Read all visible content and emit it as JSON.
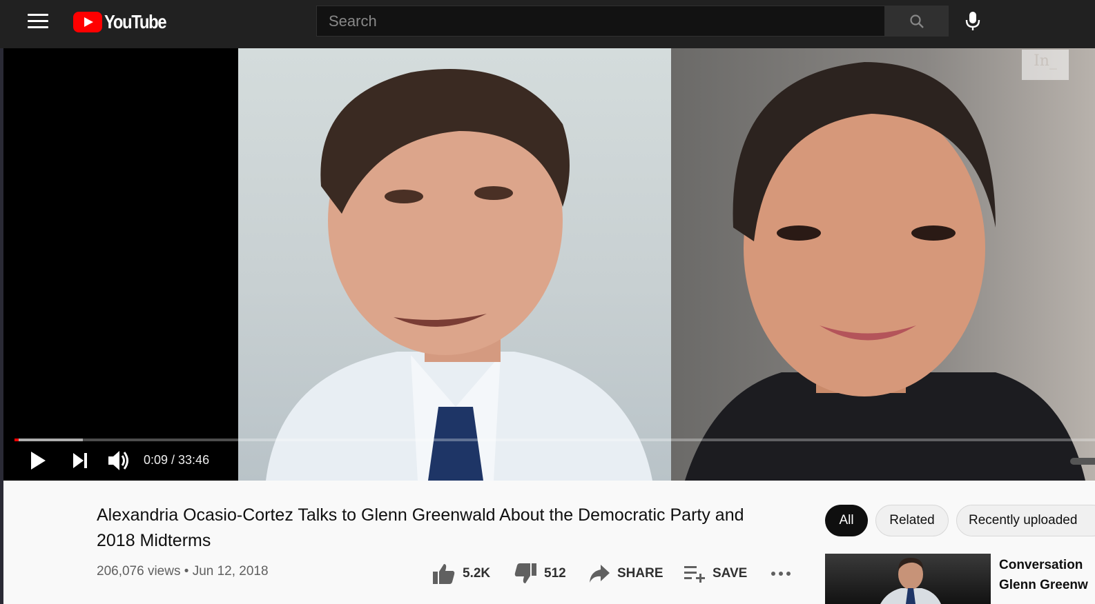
{
  "header": {
    "logo_text": "YouTube",
    "search_placeholder": "Search"
  },
  "player": {
    "time_display": "0:09 / 33:46",
    "watermark": "In_",
    "progress_played_fraction": 0.004,
    "progress_buffered_fraction": 0.063
  },
  "video": {
    "title": "Alexandria Ocasio-Cortez Talks to Glenn Greenwald About the Democratic Party and 2018 Midterms",
    "views": "206,076 views",
    "separator": "•",
    "date": "Jun 12, 2018"
  },
  "actions": {
    "like_count": "5.2K",
    "dislike_count": "512",
    "share_label": "SHARE",
    "save_label": "SAVE"
  },
  "chips": [
    "All",
    "Related",
    "Recently uploaded"
  ],
  "related": {
    "first_title": "Conversation",
    "first_channel": "Glenn Greenw"
  },
  "colors": {
    "topbar": "#212121",
    "brand_red": "#ff0000",
    "page_bg": "#f9f9f9"
  }
}
